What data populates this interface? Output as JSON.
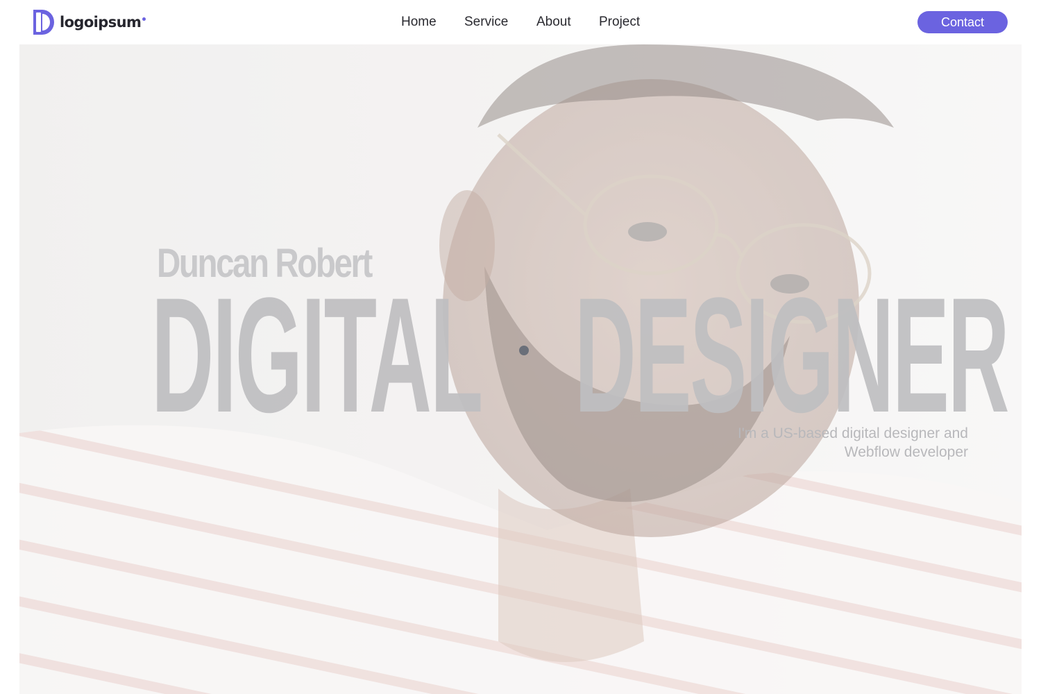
{
  "header": {
    "logo_text": "logoipsum",
    "nav": [
      {
        "label": "Home"
      },
      {
        "label": "Service"
      },
      {
        "label": "About"
      },
      {
        "label": "Project"
      }
    ],
    "contact_label": "Contact"
  },
  "hero": {
    "name": "Duncan Robert",
    "headline_left": "DIGITAL",
    "headline_right": "DESIGNER",
    "tagline_line1": "I'm a US-based digital designer and",
    "tagline_line2": "Webflow developer"
  },
  "colors": {
    "accent": "#6b63e0",
    "header_bg": "#ffffff",
    "headline": "#bebec1",
    "bullet": "#6a6f79"
  },
  "icons": {
    "logo_mark": "logo-mark-icon"
  }
}
